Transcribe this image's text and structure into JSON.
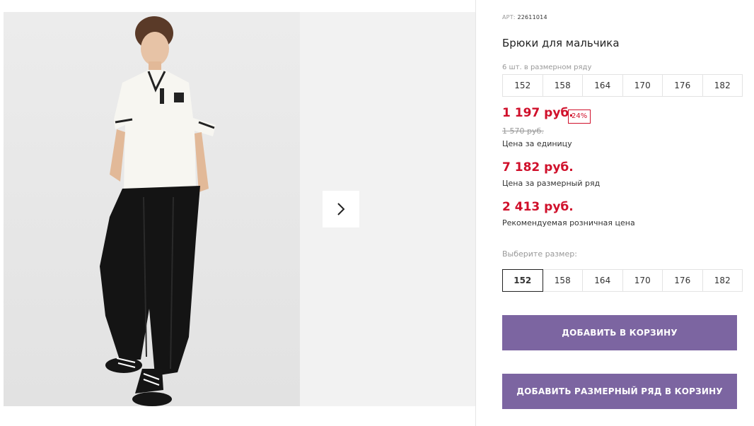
{
  "product": {
    "sku_label": "АРТ:",
    "sku_value": "22611014",
    "title": "Брюки для мальчика",
    "row_note": "6 шт. в размерном ряду",
    "size_row": [
      "152",
      "158",
      "164",
      "170",
      "176",
      "182"
    ]
  },
  "pricing": {
    "unit_price": "1 197 руб.",
    "discount": "24%",
    "old_price": "1 570 руб.",
    "unit_caption": "Цена за единицу",
    "row_price": "7 182 руб.",
    "row_caption": "Цена за размерный ряд",
    "retail_price": "2 413 руб.",
    "retail_caption": "Рекомендуемая розничная цена"
  },
  "size_picker": {
    "label": "Выберите размер:",
    "options": [
      "152",
      "158",
      "164",
      "170",
      "176",
      "182"
    ],
    "selected": "152"
  },
  "actions": {
    "add_to_cart": "ДОБАВИТЬ В КОРЗИНУ",
    "add_row_to_cart": "ДОБАВИТЬ РАЗМЕРНЫЙ РЯД В КОРЗИНУ"
  },
  "colors": {
    "accent": "#7c65a1",
    "price_red": "#d0102b"
  },
  "icons": {
    "gallery_next": "chevron-right-icon"
  }
}
